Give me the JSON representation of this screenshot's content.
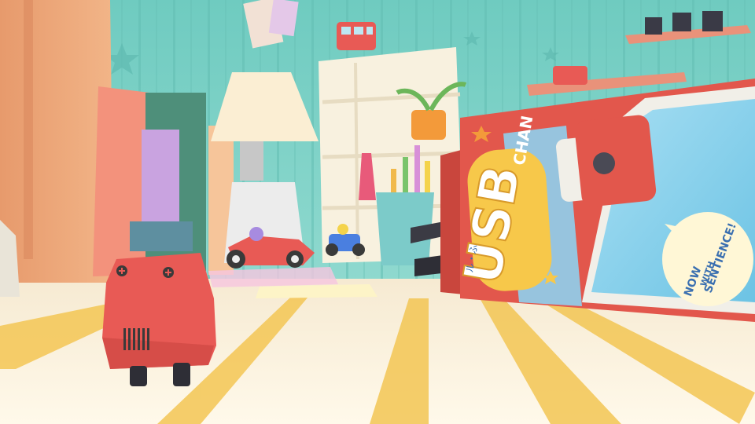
{
  "scene": {
    "box": {
      "brand": "USB",
      "subtitle": "CHAN",
      "tagline_top": "NOW",
      "tagline_mid": "WITH",
      "tagline_bottom": "SENTIENCE!",
      "side_logo": "ル・ふ"
    }
  },
  "colors": {
    "wall": "#7fd3c8",
    "floor": "#fbf3da",
    "rug_stripe": "#f4c95a",
    "robot": "#e85a55",
    "box_red": "#e2574c",
    "box_yellow": "#f7c84a",
    "box_blue": "#8fd0ee"
  }
}
